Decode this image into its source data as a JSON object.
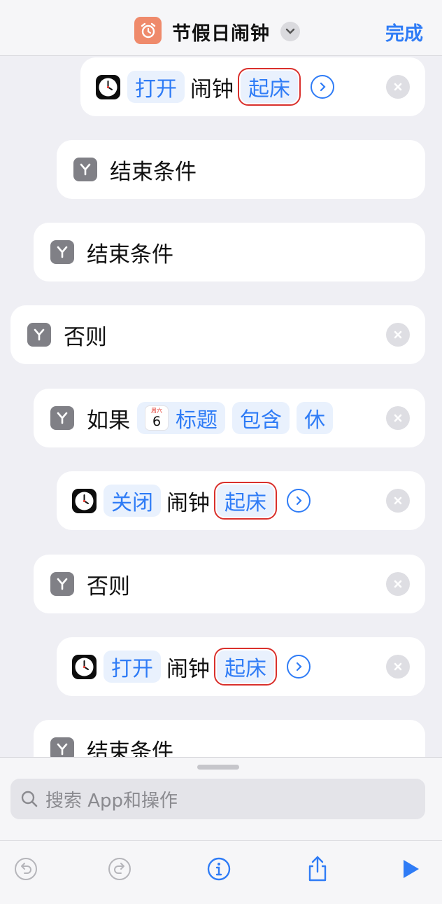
{
  "header": {
    "title": "节假日闹钟",
    "done_label": "完成",
    "app_icon": "alarm-clock-icon",
    "accent_color": "#2f7cf6"
  },
  "rows": [
    {
      "kind": "clock-action",
      "verb": "打开",
      "object": "闹钟",
      "value": "起床"
    },
    {
      "kind": "control",
      "label": "结束条件"
    },
    {
      "kind": "control",
      "label": "结束条件"
    },
    {
      "kind": "control",
      "label": "否则"
    },
    {
      "kind": "condition",
      "label": "如果",
      "calendar_day": "周六",
      "calendar_date": "6",
      "field": "标题",
      "operator": "包含",
      "value": "休"
    },
    {
      "kind": "clock-action",
      "verb": "关闭",
      "object": "闹钟",
      "value": "起床"
    },
    {
      "kind": "control",
      "label": "否则"
    },
    {
      "kind": "clock-action",
      "verb": "打开",
      "object": "闹钟",
      "value": "起床"
    },
    {
      "kind": "control",
      "label": "结束条件"
    }
  ],
  "sheet": {
    "search_placeholder": "搜索 App和操作",
    "toolbar": [
      "undo-icon",
      "redo-icon",
      "info-icon",
      "share-icon",
      "play-icon"
    ]
  }
}
